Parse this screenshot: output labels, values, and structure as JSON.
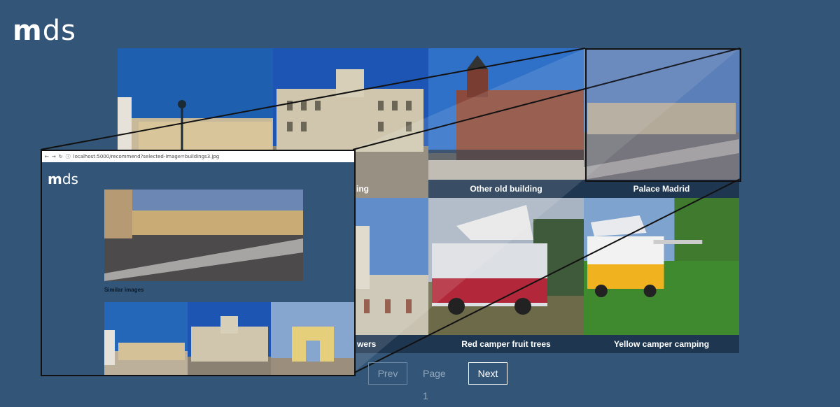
{
  "app": {
    "logo_bold": "m",
    "logo_rest": "ds"
  },
  "gallery": {
    "row1": [
      {
        "caption": ""
      },
      {
        "caption": ""
      },
      {
        "caption": "Other old building"
      },
      {
        "caption": "Palace Madrid"
      }
    ],
    "row2": [
      {
        "caption": ""
      },
      {
        "caption": "wers"
      },
      {
        "caption": "Red camper fruit trees"
      },
      {
        "caption": "Yellow camper camping"
      }
    ],
    "partial_caption_row1": "ilding"
  },
  "pagination": {
    "prev_label": "Prev",
    "page_label": "Page 1",
    "next_label": "Next"
  },
  "inset": {
    "url": "localhost:5000/recommend?selected-image=buildings3.jpg",
    "logo_bold": "m",
    "logo_rest": "ds",
    "similar_label": "Similar images"
  }
}
